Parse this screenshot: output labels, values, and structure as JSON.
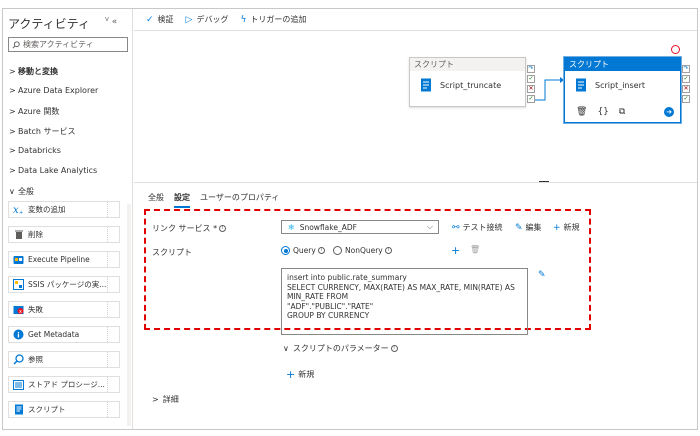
{
  "left_panel": {
    "title": "アクティビティ",
    "controls": "« «",
    "search_placeholder": "検索アクティビティ",
    "categories": [
      {
        "chevron": ">",
        "label": "移動と変換"
      },
      {
        "chevron": ">",
        "label": "Azure Data Explorer"
      },
      {
        "chevron": ">",
        "label": "Azure 関数"
      },
      {
        "chevron": ">",
        "label": "Batch サービス"
      },
      {
        "chevron": ">",
        "label": "Databricks"
      },
      {
        "chevron": ">",
        "label": "Data Lake Analytics"
      },
      {
        "chevron": "∨",
        "label": "全般"
      }
    ],
    "activities": [
      {
        "label": "変数の追加",
        "icon": "variable-icon"
      },
      {
        "label": "削除",
        "icon": "trash-icon"
      },
      {
        "label": "Execute Pipeline",
        "icon": "pipeline-icon"
      },
      {
        "label": "SSIS パッケージの実...",
        "icon": "ssis-icon"
      },
      {
        "label": "失敗",
        "icon": "fail-icon"
      },
      {
        "label": "Get Metadata",
        "icon": "info-icon"
      },
      {
        "label": "参照",
        "icon": "lookup-icon"
      },
      {
        "label": "ストアド プロシージ...",
        "icon": "stored-procedure-icon"
      },
      {
        "label": "スクリプト",
        "icon": "script-icon"
      }
    ]
  },
  "toolbar": {
    "validate": "検証",
    "debug": "デバッグ",
    "add_trigger": "トリガーの追加"
  },
  "canvas": {
    "node_a": {
      "header": "スクリプト",
      "name": "Script_truncate"
    },
    "node_b": {
      "header": "スクリプト",
      "name": "Script_insert"
    }
  },
  "properties": {
    "tabs": [
      {
        "label": "全般",
        "active": false
      },
      {
        "label": "設定",
        "active": true
      },
      {
        "label": "ユーザーのプロパティ",
        "active": false
      }
    ],
    "linked_service_label": "リンク サービス *",
    "linked_service_value": "Snowflake_ADF",
    "test_connection": "テスト接続",
    "edit": "編集",
    "new": "新規",
    "script_label": "スクリプト",
    "radio_query": "Query",
    "radio_nonquery": "NonQuery",
    "query_selected": true,
    "script_text": "insert into public.rate_summary\nSELECT CURRENCY, MAX(RATE) AS MAX_RATE, MIN(RATE) AS\nMIN_RATE FROM\n\"ADF\".\"PUBLIC\".\"RATE\"\nGROUP BY CURRENCY",
    "script_params": "スクリプトのパラメーター",
    "params_new": "新規",
    "details": "詳細"
  },
  "colors": {
    "accent": "#0078d4",
    "highlight_dash": "#e00000"
  }
}
